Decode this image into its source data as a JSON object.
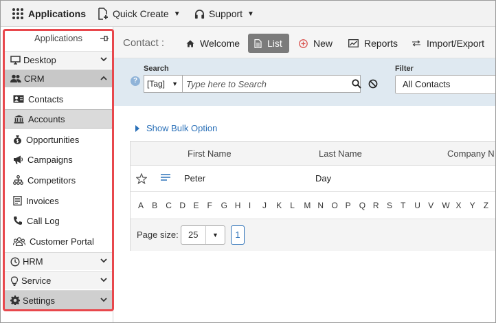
{
  "topbar": {
    "brand": "Applications",
    "quick_create": "Quick Create",
    "support": "Support"
  },
  "sidebar": {
    "header": "Applications",
    "sections": {
      "desktop": "Desktop",
      "crm": "CRM",
      "hrm": "HRM",
      "service": "Service",
      "settings": "Settings"
    },
    "crm_items": [
      {
        "label": "Contacts",
        "icon": "contact-card-icon"
      },
      {
        "label": "Accounts",
        "icon": "bank-icon",
        "active": true
      },
      {
        "label": "Opportunities",
        "icon": "money-bag-icon"
      },
      {
        "label": "Campaigns",
        "icon": "megaphone-icon"
      },
      {
        "label": "Competitors",
        "icon": "hierarchy-icon"
      },
      {
        "label": "Invoices",
        "icon": "invoice-icon"
      },
      {
        "label": "Call Log",
        "icon": "phone-icon"
      },
      {
        "label": "Customer Portal",
        "icon": "users-icon"
      }
    ]
  },
  "toolbar": {
    "title": "Contact :",
    "welcome": "Welcome",
    "list": "List",
    "new": "New",
    "reports": "Reports",
    "import_export": "Import/Export"
  },
  "search": {
    "label": "Search",
    "tag": "[Tag]",
    "placeholder": "Type here to Search",
    "filter_label": "Filter",
    "filter_value": "All Contacts"
  },
  "bulk_option": "Show Bulk Option",
  "grid": {
    "columns": [
      "First Name",
      "Last Name",
      "Company N"
    ],
    "rows": [
      {
        "first_name": "Peter",
        "last_name": "Day"
      }
    ],
    "alphabet": [
      "A",
      "B",
      "C",
      "D",
      "E",
      "F",
      "G",
      "H",
      "I",
      "J",
      "K",
      "L",
      "M",
      "N",
      "O",
      "P",
      "Q",
      "R",
      "S",
      "T",
      "U",
      "V",
      "W",
      "X",
      "Y",
      "Z"
    ],
    "page_size_label": "Page size:",
    "page_size": "25",
    "current_page": "1"
  },
  "colors": {
    "accent_blue": "#2a70b8",
    "highlight_red": "#e8474c",
    "panel_blue": "#dfe9f1",
    "new_icon_red": "#d9534f"
  }
}
